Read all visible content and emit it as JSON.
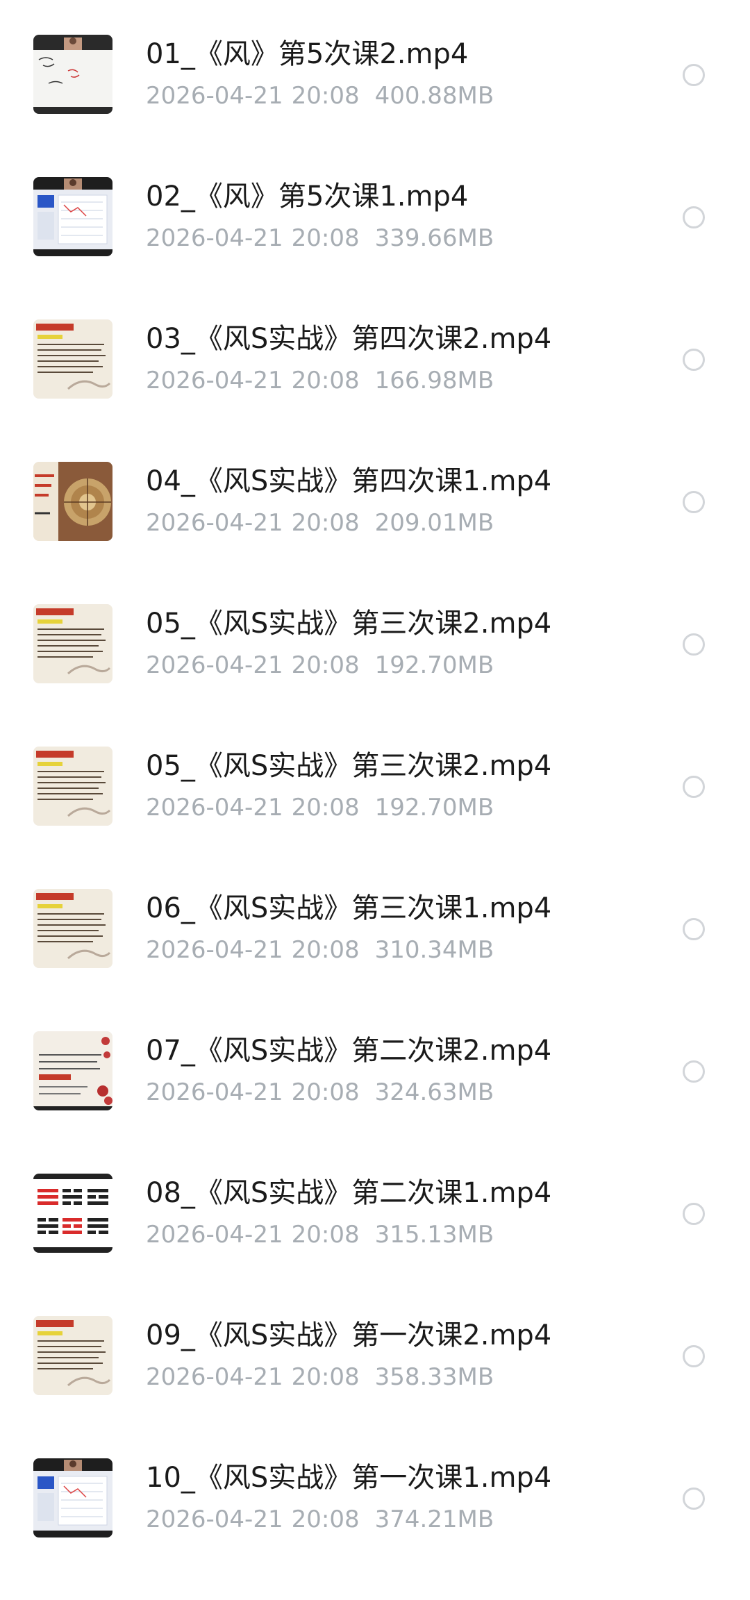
{
  "files": [
    {
      "name": "01_《风》第5次课2.mp4",
      "date": "2026-04-21",
      "time": "20:08",
      "size": "400.88MB",
      "thumb": "thumb-lecture-whiteboard-icon"
    },
    {
      "name": "02_《风》第5次课1.mp4",
      "date": "2026-04-21",
      "time": "20:08",
      "size": "339.66MB",
      "thumb": "thumb-lecture-screen-icon"
    },
    {
      "name": "03_《风S实战》第四次课2.mp4",
      "date": "2026-04-21",
      "time": "20:08",
      "size": "166.98MB",
      "thumb": "thumb-slide-text-icon"
    },
    {
      "name": "04_《风S实战》第四次课1.mp4",
      "date": "2026-04-21",
      "time": "20:08",
      "size": "209.01MB",
      "thumb": "thumb-compass-slide-icon"
    },
    {
      "name": "05_《风S实战》第三次课2.mp4",
      "date": "2026-04-21",
      "time": "20:08",
      "size": "192.70MB",
      "thumb": "thumb-slide-text-icon"
    },
    {
      "name": "05_《风S实战》第三次课2.mp4",
      "date": "2026-04-21",
      "time": "20:08",
      "size": "192.70MB",
      "thumb": "thumb-slide-text-icon"
    },
    {
      "name": "06_《风S实战》第三次课1.mp4",
      "date": "2026-04-21",
      "time": "20:08",
      "size": "310.34MB",
      "thumb": "thumb-slide-text-icon"
    },
    {
      "name": "07_《风S实战》第二次课2.mp4",
      "date": "2026-04-21",
      "time": "20:08",
      "size": "324.63MB",
      "thumb": "thumb-slide-plum-icon"
    },
    {
      "name": "08_《风S实战》第二次课1.mp4",
      "date": "2026-04-21",
      "time": "20:08",
      "size": "315.13MB",
      "thumb": "thumb-trigram-icon"
    },
    {
      "name": "09_《风S实战》第一次课2.mp4",
      "date": "2026-04-21",
      "time": "20:08",
      "size": "358.33MB",
      "thumb": "thumb-slide-text-icon"
    },
    {
      "name": "10_《风S实战》第一次课1.mp4",
      "date": "2026-04-21",
      "time": "20:08",
      "size": "374.21MB",
      "thumb": "thumb-lecture-screen-icon"
    }
  ],
  "colors": {
    "name_text": "#1a1a1a",
    "meta_text": "#a7adb3",
    "radio_border": "#d2d5d9",
    "background": "#ffffff"
  }
}
